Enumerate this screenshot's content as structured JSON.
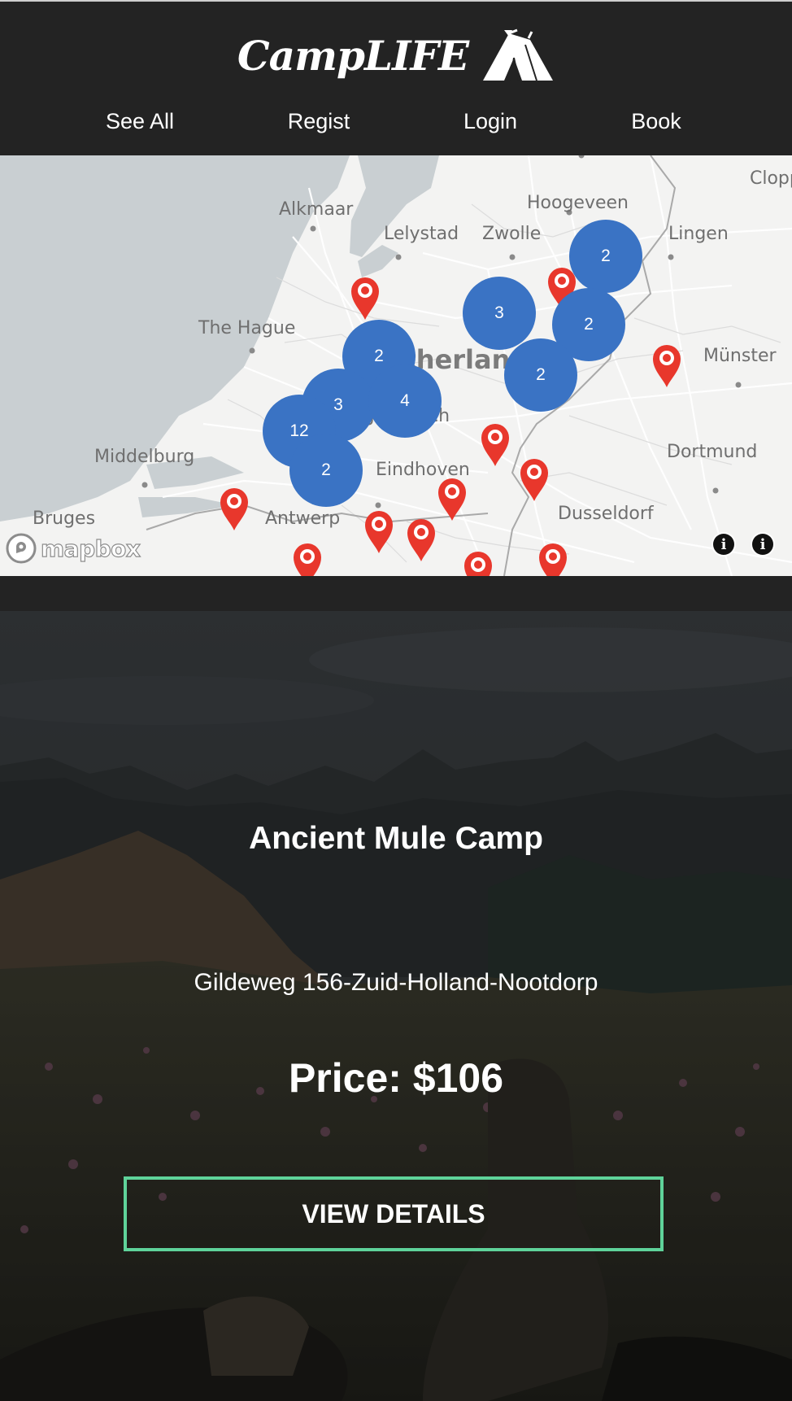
{
  "brand": {
    "name": "CampLIFE",
    "logo_icon": "tent-icon"
  },
  "nav": {
    "items": [
      {
        "label": "See All"
      },
      {
        "label": "Regist"
      },
      {
        "label": "Login"
      },
      {
        "label": "Book"
      }
    ]
  },
  "map": {
    "labels": [
      "Cloppenburg",
      "Hoogeveen",
      "Alkmaar",
      "Lelystad",
      "Zwolle",
      "Lingen",
      "The Hague",
      "Netherlands",
      "Münster",
      "'s-Hertogenbosch",
      "Middelburg",
      "Eindhoven",
      "Dortmund",
      "Bruges",
      "Antwerp",
      "Dusseldorf"
    ],
    "clusters": [
      "2",
      "3",
      "2",
      "2",
      "2",
      "3",
      "4",
      "12",
      "2"
    ],
    "marker_icon": "map-pin-icon",
    "attribution": "mapbox",
    "attribution_icon": "mapbox-logo-icon",
    "info_icon": "info-icon",
    "colors": {
      "cluster": "#3a73c4",
      "marker": "#e8372c"
    }
  },
  "camp": {
    "title": "Ancient Mule Camp",
    "address": "Gildeweg 156-Zuid-Holland-Nootdorp",
    "price": "Price: $106",
    "button": "VIEW DETAILS",
    "button_border_color": "#5fd39a"
  }
}
